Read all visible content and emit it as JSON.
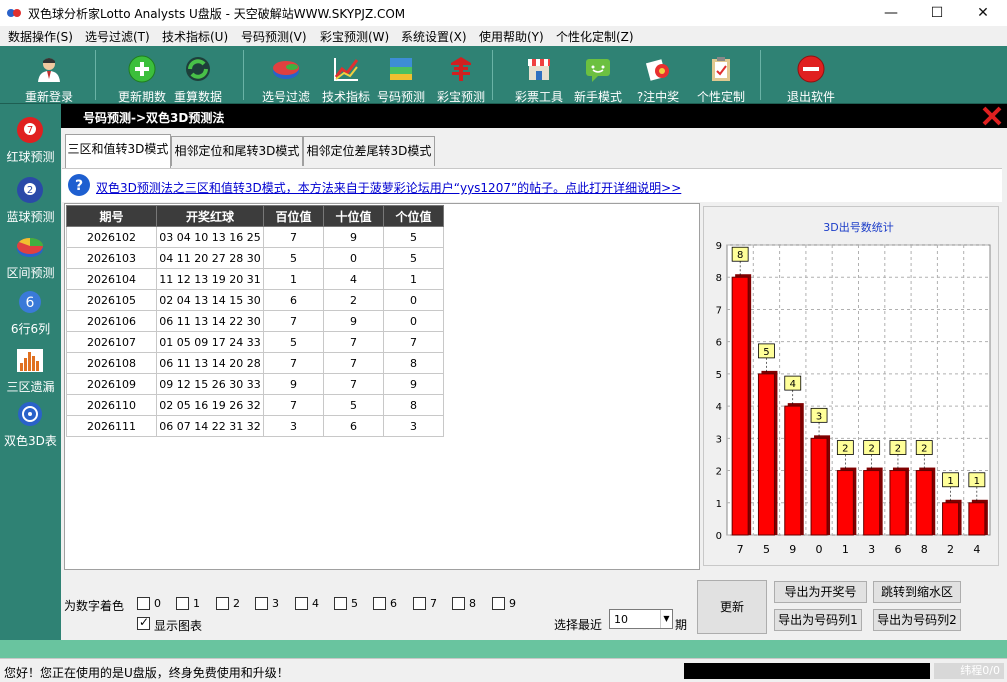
{
  "window": {
    "title": "双色球分析家Lotto Analysts U盘版 - 天空破解站WWW.SKYPJZ.COM",
    "minimize": "—",
    "maximize": "☐",
    "close": "✕"
  },
  "menu": [
    "数据操作(S)",
    "选号过滤(T)",
    "技术指标(U)",
    "号码预测(V)",
    "彩宝预测(W)",
    "系统设置(X)",
    "使用帮助(Y)",
    "个性化定制(Z)"
  ],
  "toolbar": {
    "buttons": [
      {
        "label": "重新登录",
        "icon": "user-icon"
      },
      {
        "label": "更新期数",
        "icon": "plus-icon"
      },
      {
        "label": "重算数据",
        "icon": "recycle-icon"
      },
      {
        "label": "选号过滤",
        "icon": "filter-icon"
      },
      {
        "label": "技术指标",
        "icon": "chart-line-icon"
      },
      {
        "label": "号码预测",
        "icon": "book-icon"
      },
      {
        "label": "彩宝预测",
        "icon": "treasure-icon"
      },
      {
        "label": "彩票工具",
        "icon": "store-icon"
      },
      {
        "label": "新手模式",
        "icon": "chat-icon"
      },
      {
        "label": "?注中奖",
        "icon": "award-icon"
      },
      {
        "label": "个性定制",
        "icon": "clipboard-icon"
      },
      {
        "label": "退出软件",
        "icon": "exit-icon"
      }
    ]
  },
  "sidebar": [
    {
      "label": "红球预测",
      "icon": "red-ball-icon"
    },
    {
      "label": "蓝球预测",
      "icon": "blue-ball-icon"
    },
    {
      "label": "区间预测",
      "icon": "pie-icon"
    },
    {
      "label": "6行6列",
      "icon": "six-icon"
    },
    {
      "label": "三区遗漏",
      "icon": "bars-icon"
    },
    {
      "label": "双色3D表",
      "icon": "globe-icon"
    }
  ],
  "panel": {
    "title": "号码预测->双色3D预测法"
  },
  "tabs": [
    "三区和值转3D模式",
    "相邻定位和尾转3D模式",
    "相邻定位差尾转3D模式"
  ],
  "info_link": "双色3D预测法之三区和值转3D模式，本方法来自于菠萝彩论坛用户“yys1207”的帖子。点此打开详细说明>>",
  "table": {
    "headers": [
      "期号",
      "开奖红球",
      "百位值",
      "十位值",
      "个位值"
    ],
    "rows": [
      [
        "2026102",
        "03 04 10 13 16 25",
        "7",
        "9",
        "5"
      ],
      [
        "2026103",
        "04 11 20 27 28 30",
        "5",
        "0",
        "5"
      ],
      [
        "2026104",
        "11 12 13 19 20 31",
        "1",
        "4",
        "1"
      ],
      [
        "2026105",
        "02 04 13 14 15 30",
        "6",
        "2",
        "0"
      ],
      [
        "2026106",
        "06 11 13 14 22 30",
        "7",
        "9",
        "0"
      ],
      [
        "2026107",
        "01 05 09 17 24 33",
        "5",
        "7",
        "7"
      ],
      [
        "2026108",
        "06 11 13 14 20 28",
        "7",
        "7",
        "8"
      ],
      [
        "2026109",
        "09 12 15 26 30 33",
        "9",
        "7",
        "9"
      ],
      [
        "2026110",
        "02 05 16 19 26 32",
        "7",
        "5",
        "8"
      ],
      [
        "2026111",
        "06 07 14 22 31 32",
        "3",
        "6",
        "3"
      ]
    ]
  },
  "chart_data": {
    "type": "bar",
    "title": "3D出号数统计",
    "categories": [
      "7",
      "5",
      "9",
      "0",
      "1",
      "3",
      "6",
      "8",
      "2",
      "4"
    ],
    "values": [
      8,
      5,
      4,
      3,
      2,
      2,
      2,
      2,
      1,
      1
    ],
    "ylim": [
      0,
      9
    ],
    "yticks": [
      "0",
      "1",
      "2",
      "3",
      "4",
      "5",
      "6",
      "7",
      "8",
      "9"
    ],
    "grid": true,
    "bar_color": "#ff0000",
    "label_bg": "#ffff99"
  },
  "controls": {
    "color_label": "为数字着色",
    "digits": [
      "0",
      "1",
      "2",
      "3",
      "4",
      "5",
      "6",
      "7",
      "8",
      "9"
    ],
    "show_chart_label": "显示图表",
    "show_chart_checked": true,
    "recent_label": "选择最近",
    "recent_value": "10",
    "recent_unit": "期",
    "update_button": "更新",
    "export_draw": "导出为开奖号",
    "jump_shrink": "跳转到缩水区",
    "export_list1": "导出为号码列1",
    "export_list2": "导出为号码列2"
  },
  "status": {
    "message": "您好！您正在使用的是U盘版，终身免费使用和升级！",
    "right": "纬程0/0"
  }
}
